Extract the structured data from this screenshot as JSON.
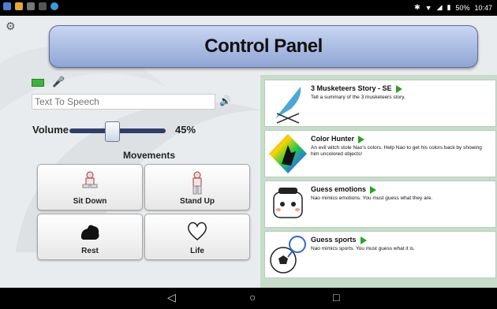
{
  "status_bar": {
    "time": "10:47",
    "battery": "50%"
  },
  "header": {
    "title": "Control Panel"
  },
  "tts": {
    "placeholder": "Text To Speech"
  },
  "volume": {
    "label": "Volume",
    "value_text": "45%",
    "value": 0.45
  },
  "movements": {
    "title": "Movements",
    "buttons": [
      {
        "label": "Sit Down"
      },
      {
        "label": "Stand Up"
      },
      {
        "label": "Rest"
      },
      {
        "label": "Life"
      }
    ]
  },
  "stories": [
    {
      "title": "3 Musketeers Story - SE",
      "description": "Tell a summary of the 3 musketeers story."
    },
    {
      "title": "Color Hunter",
      "description": "An evil witch stole Nao's colors. Help Nao to get his colors back by showing him uncolored objects!"
    },
    {
      "title": "Guess emotions",
      "description": "Nao mimics emotions. You must guess what they are."
    },
    {
      "title": "Guess sports",
      "description": "Nao mimics sports. You must guess what it is."
    }
  ],
  "colors": {
    "accent": "#28a428",
    "header_top": "#c9d6f2",
    "header_bottom": "#8fa5d4",
    "slider": "#2d3f6b"
  }
}
